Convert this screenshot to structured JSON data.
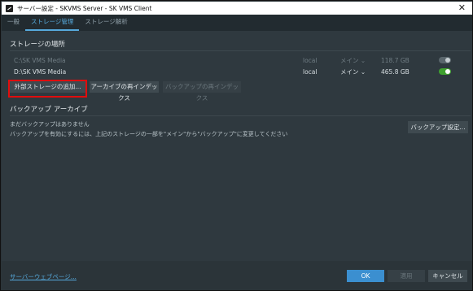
{
  "window": {
    "title": "サーバー設定 - SKVMS Server - SK VMS Client",
    "close_glyph": "✕"
  },
  "tabs": [
    {
      "label": "一般"
    },
    {
      "label": "ストレージ管理"
    },
    {
      "label": "ストレージ解析"
    }
  ],
  "storage": {
    "section_title": "ストレージの場所",
    "rows": [
      {
        "path": "C:\\SK VMS Media",
        "type": "local",
        "role": "メイン ⌄",
        "size": "118.7 GB",
        "enabled": false
      },
      {
        "path": "D:\\SK VMS Media",
        "type": "local",
        "role": "メイン ⌄",
        "size": "465.8 GB",
        "enabled": true
      }
    ],
    "buttons": {
      "add_external": "外部ストレージの追加...",
      "reindex_archive": "アーカイブの再インデックス",
      "reindex_backup": "バックアップの再インデックス"
    }
  },
  "backup": {
    "section_title": "バックアップ アーカイブ",
    "no_backup": "まだバックアップはありません",
    "hint": "バックアップを有効にするには、上記のストレージの一部を\"メイン\"から\"バックアップ\"に変更してください",
    "settings_button": "バックアップ設定..."
  },
  "footer": {
    "web_link": "サーバーウェブページ...",
    "ok": "OK",
    "apply": "適用",
    "cancel": "キャンセル"
  },
  "colors": {
    "accent": "#56a9dc",
    "highlight_box": "#e00d0d",
    "toggle_on": "#3fa12f",
    "ok_button": "#3b8fd0"
  }
}
